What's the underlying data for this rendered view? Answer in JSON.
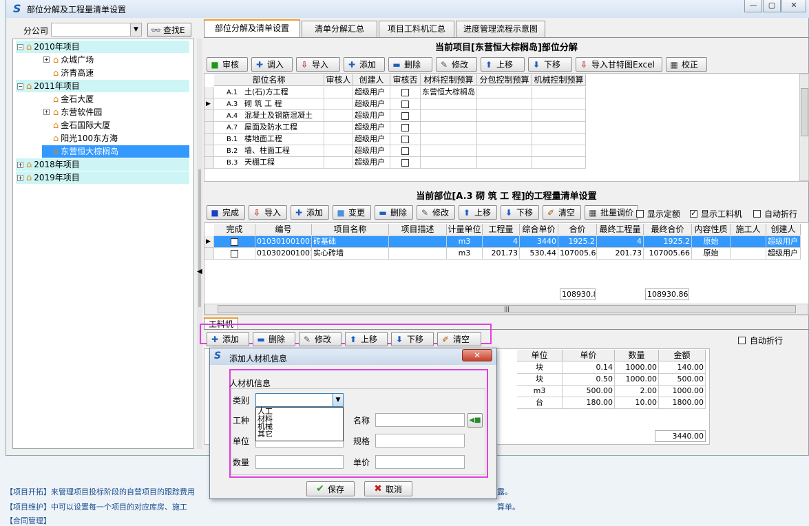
{
  "window": {
    "title": "部位分解及工程量清单设置"
  },
  "left": {
    "company_label": "分公司",
    "search_button": "查找E",
    "tree": [
      {
        "label": "2010年项目",
        "level": 0,
        "expanded": true,
        "highlight": true
      },
      {
        "label": "众城广场",
        "level": 1,
        "expand": true
      },
      {
        "label": "济青高速",
        "level": 1
      },
      {
        "label": "2011年项目",
        "level": 0,
        "expanded": true,
        "highlight": true
      },
      {
        "label": "金石大厦",
        "level": 1
      },
      {
        "label": "东营软件园",
        "level": 1,
        "expand": true
      },
      {
        "label": "金石国际大厦",
        "level": 1
      },
      {
        "label": "阳光100东方海",
        "level": 1
      },
      {
        "label": "东营恒大棕榈岛",
        "level": 1,
        "selected": true
      },
      {
        "label": "2018年项目",
        "level": 0,
        "highlight": true
      },
      {
        "label": "2019年项目",
        "level": 0,
        "highlight": true
      }
    ]
  },
  "tabs": [
    "部位分解及清单设置",
    "清单分解汇总",
    "项目工料机汇总",
    "进度管理流程示意图"
  ],
  "section1": {
    "title": "当前项目[东营恒大棕榈岛]部位分解",
    "buttons": [
      "审核",
      "调入",
      "导入",
      "添加",
      "删除",
      "修改",
      "上移",
      "下移",
      "导入甘特图Excel",
      "校正"
    ],
    "headers": [
      "部位名称",
      "审核人",
      "创建人",
      "审核否",
      "材料控制预算",
      "分包控制预算",
      "机械控制预算"
    ],
    "rows": [
      {
        "code": "A.1",
        "name": "土(石)方工程",
        "creator": "超级用户",
        "material": "东营恒大棕榈岛"
      },
      {
        "code": "A.3",
        "name": "砌 筑 工 程",
        "creator": "超级用户",
        "material": ""
      },
      {
        "code": "A.4",
        "name": "混凝土及钢筋混凝土",
        "creator": "超级用户",
        "material": ""
      },
      {
        "code": "A.7",
        "name": "屋面及防水工程",
        "creator": "超级用户",
        "material": ""
      },
      {
        "code": "B.1",
        "name": "楼地面工程",
        "creator": "超级用户",
        "material": ""
      },
      {
        "code": "B.2",
        "name": "墙、柱面工程",
        "creator": "超级用户",
        "material": ""
      },
      {
        "code": "B.3",
        "name": "天棚工程",
        "creator": "超级用户",
        "material": ""
      }
    ]
  },
  "section2": {
    "title": "当前部位[A.3   砌 筑 工 程]的工程量清单设置",
    "buttons": [
      "完成",
      "导入",
      "添加",
      "变更",
      "删除",
      "修改",
      "上移",
      "下移",
      "清空",
      "批量调价"
    ],
    "checks": [
      {
        "label": "显示定额",
        "checked": false
      },
      {
        "label": "显示工料机",
        "checked": true
      },
      {
        "label": "自动折行",
        "checked": false
      }
    ],
    "headers": [
      "完成",
      "编号",
      "项目名称",
      "项目描述",
      "计量单位",
      "工程量",
      "综合单价",
      "合价",
      "最终工程量",
      "最终合价",
      "内容性质",
      "施工人",
      "创建人"
    ],
    "rows": [
      {
        "code": "010301001001",
        "name": "砖基础",
        "unit": "m3",
        "qty": "4",
        "price": "3440",
        "total": "1925.2",
        "fqty": "4",
        "ftotal": "1925.2",
        "nature": "原始",
        "creator": "超级用户",
        "selected": true
      },
      {
        "code": "010302001001",
        "name": "实心砖墙",
        "unit": "m3",
        "qty": "201.73",
        "price": "530.44",
        "total": "107005.66",
        "fqty": "201.73",
        "ftotal": "107005.66",
        "nature": "原始",
        "creator": "超级用户"
      }
    ],
    "sum_total": "108930.8",
    "sum_ftotal": "108930.86"
  },
  "section3": {
    "tab": "工料机",
    "buttons": [
      "添加",
      "删除",
      "修改",
      "上移",
      "下移",
      "清空"
    ],
    "autowrap": "自动折行",
    "headers": [
      "单位",
      "单价",
      "数量",
      "金额"
    ],
    "rows": [
      {
        "unit": "块",
        "price": "0.14",
        "qty": "1000.00",
        "amount": "140.00"
      },
      {
        "unit": "块",
        "price": "0.50",
        "qty": "1000.00",
        "amount": "500.00"
      },
      {
        "unit": "m3",
        "price": "500.00",
        "qty": "2.00",
        "amount": "1000.00"
      },
      {
        "unit": "台",
        "price": "180.00",
        "qty": "10.00",
        "amount": "1800.00"
      }
    ],
    "total": "3440.00"
  },
  "dialog": {
    "title": "添加人材机信息",
    "group": "人材机信息",
    "category_label": "类别",
    "category_value": "",
    "options": [
      "人工",
      "材料",
      "机械",
      "其它"
    ],
    "worktype_label": "工种",
    "name_label": "名称",
    "unit_label": "单位",
    "spec_label": "规格",
    "qty_label": "数量",
    "price_label": "单价",
    "save": "保存",
    "cancel": "取消"
  },
  "info": [
    "【项目开拓】来管理项目投标阶段的自营项目的跟踪费用",
    "【项目维护】中可以设置每一个项目的对应库房、施工",
    "【合同管理】"
  ],
  "info_right": [
    "露。",
    "算单。"
  ]
}
